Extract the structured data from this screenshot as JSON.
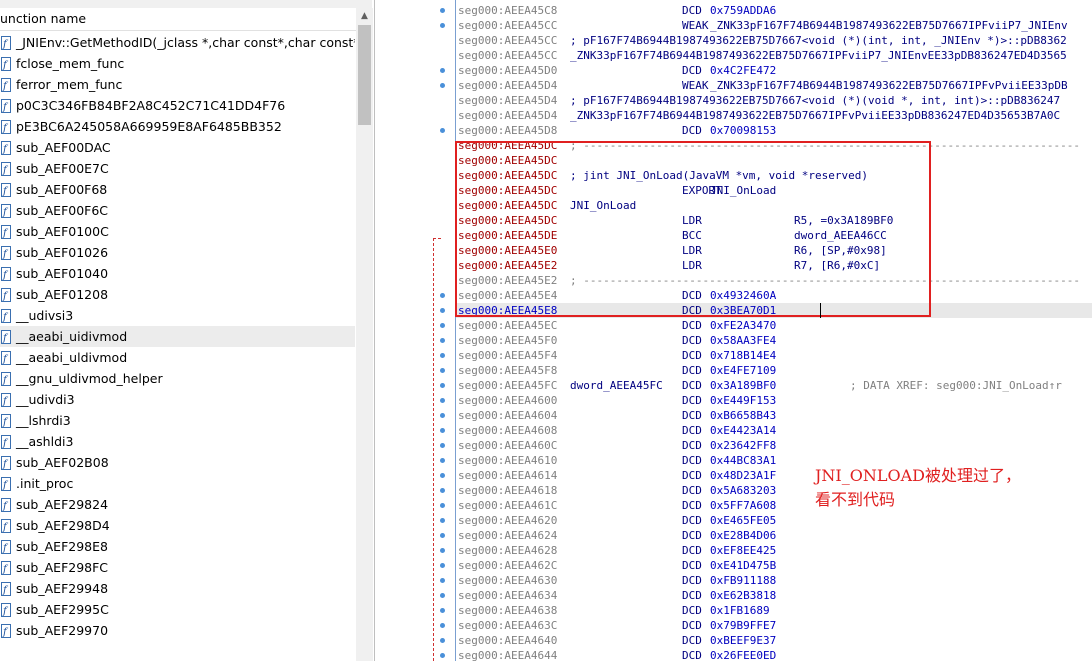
{
  "functions_window": {
    "column_header": "unction name",
    "items": [
      {
        "label": "_JNIEnv::GetMethodID(_jclass *,char const*,char const*)"
      },
      {
        "label": "fclose_mem_func"
      },
      {
        "label": "ferror_mem_func"
      },
      {
        "label": "p0C3C346FB84BF2A8C452C71C41DD4F76"
      },
      {
        "label": "pE3BC6A245058A669959E8AF6485BB352"
      },
      {
        "label": "sub_AEF00DAC"
      },
      {
        "label": "sub_AEF00E7C"
      },
      {
        "label": "sub_AEF00F68"
      },
      {
        "label": "sub_AEF00F6C"
      },
      {
        "label": "sub_AEF0100C"
      },
      {
        "label": "sub_AEF01026"
      },
      {
        "label": "sub_AEF01040"
      },
      {
        "label": "sub_AEF01208"
      },
      {
        "label": "__udivsi3"
      },
      {
        "label": "__aeabi_uidivmod",
        "selected": true
      },
      {
        "label": "__aeabi_uldivmod"
      },
      {
        "label": "__gnu_uldivmod_helper"
      },
      {
        "label": "__udivdi3"
      },
      {
        "label": "__lshrdi3"
      },
      {
        "label": "__ashldi3"
      },
      {
        "label": "sub_AEF02B08"
      },
      {
        "label": ".init_proc"
      },
      {
        "label": "sub_AEF29824"
      },
      {
        "label": "sub_AEF298D4"
      },
      {
        "label": "sub_AEF298E8"
      },
      {
        "label": "sub_AEF298FC"
      },
      {
        "label": "sub_AEF29948"
      },
      {
        "label": "sub_AEF2995C"
      },
      {
        "label": "sub_AEF29970"
      }
    ]
  },
  "disassembly": {
    "lines": [
      {
        "addr": "seg000:AEEA45C8",
        "mnem": "DCD",
        "ops": "0x759ADDA6"
      },
      {
        "addr": "seg000:AEEA45CC",
        "mnem": "WEAK",
        "ops": "_ZNK33pF167F74B6944B1987493622EB75D7667IPFviiP7_JNIEnv"
      },
      {
        "addr": "seg000:AEEA45CC",
        "comment": "; pF167F74B6944B1987493622EB75D7667<void (*)(int, int, _JNIEnv *)>::pDB8362"
      },
      {
        "addr": "seg000:AEEA45CC",
        "label": "_ZNK33pF167F74B6944B1987493622EB75D7667IPFviiP7_JNIEnvEE33pDB836247ED4D3565"
      },
      {
        "addr": "seg000:AEEA45D0",
        "mnem": "DCD",
        "ops": "0x4C2FE472"
      },
      {
        "addr": "seg000:AEEA45D4",
        "mnem": "WEAK",
        "ops": "_ZNK33pF167F74B6944B1987493622EB75D7667IPFvPviiEE33pDB"
      },
      {
        "addr": "seg000:AEEA45D4",
        "comment": "; pF167F74B6944B1987493622EB75D7667<void (*)(void *, int, int)>::pDB836247"
      },
      {
        "addr": "seg000:AEEA45D4",
        "label": "_ZNK33pF167F74B6944B1987493622EB75D7667IPFvPviiEE33pDB836247ED4D35653B7A0C"
      },
      {
        "addr": "seg000:AEEA45D8",
        "mnem": "DCD",
        "ops": "0x70098153"
      },
      {
        "addr": "seg000:AEEA45DC",
        "red": true,
        "sep": "; ---------------------------------------------------------------------------"
      },
      {
        "addr": "seg000:AEEA45DC",
        "red": true
      },
      {
        "addr": "seg000:AEEA45DC",
        "red": true,
        "comment": "; jint JNI_OnLoad(JavaVM *vm, void *reserved)"
      },
      {
        "addr": "seg000:AEEA45DC",
        "red": true,
        "mnem": "EXPORT",
        "ops": "JNI_OnLoad"
      },
      {
        "addr": "seg000:AEEA45DC",
        "red": true,
        "label": "JNI_OnLoad"
      },
      {
        "addr": "seg000:AEEA45DC",
        "red": true,
        "mnem": "LDR",
        "ops": "R5, =0x3A189BF0"
      },
      {
        "addr": "seg000:AEEA45DE",
        "red": true,
        "mnem": "BCC",
        "ops": "dword_AEEA46CC"
      },
      {
        "addr": "seg000:AEEA45E0",
        "red": true,
        "mnem": "LDR",
        "ops": "R6, [SP,#0x98]"
      },
      {
        "addr": "seg000:AEEA45E2",
        "red": true,
        "mnem": "LDR",
        "ops": "R7, [R6,#0xC]"
      },
      {
        "addr": "seg000:AEEA45E2",
        "sep": "; ---------------------------------------------------------------------------"
      },
      {
        "addr": "seg000:AEEA45E4",
        "mnem": "DCD",
        "ops": "0x4932460A"
      },
      {
        "addr": "seg000:AEEA45E8",
        "blue": true,
        "hl": true,
        "mnem": "DCD",
        "ops": "0x3BEA70D1"
      },
      {
        "addr": "seg000:AEEA45EC",
        "mnem": "DCD",
        "ops": "0xFE2A3470"
      },
      {
        "addr": "seg000:AEEA45F0",
        "mnem": "DCD",
        "ops": "0x58AA3FE4"
      },
      {
        "addr": "seg000:AEEA45F4",
        "mnem": "DCD",
        "ops": "0x718B14E4"
      },
      {
        "addr": "seg000:AEEA45F8",
        "mnem": "DCD",
        "ops": "0xE4FE7109"
      },
      {
        "addr": "seg000:AEEA45FC",
        "label": "dword_AEEA45FC",
        "mnem": "DCD",
        "ops": "0x3A189BF0",
        "xref": "; DATA XREF: seg000:JNI_OnLoad↑r"
      },
      {
        "addr": "seg000:AEEA4600",
        "mnem": "DCD",
        "ops": "0xE449F153"
      },
      {
        "addr": "seg000:AEEA4604",
        "mnem": "DCD",
        "ops": "0xB6658B43"
      },
      {
        "addr": "seg000:AEEA4608",
        "mnem": "DCD",
        "ops": "0xE4423A14"
      },
      {
        "addr": "seg000:AEEA460C",
        "mnem": "DCD",
        "ops": "0x23642FF8"
      },
      {
        "addr": "seg000:AEEA4610",
        "mnem": "DCD",
        "ops": "0x44BC83A1"
      },
      {
        "addr": "seg000:AEEA4614",
        "mnem": "DCD",
        "ops": "0x48D23A1F"
      },
      {
        "addr": "seg000:AEEA4618",
        "mnem": "DCD",
        "ops": "0x5A683203"
      },
      {
        "addr": "seg000:AEEA461C",
        "mnem": "DCD",
        "ops": "0x5FF7A608"
      },
      {
        "addr": "seg000:AEEA4620",
        "mnem": "DCD",
        "ops": "0xE465FE05"
      },
      {
        "addr": "seg000:AEEA4624",
        "mnem": "DCD",
        "ops": "0xE28B4D06"
      },
      {
        "addr": "seg000:AEEA4628",
        "mnem": "DCD",
        "ops": "0xEF8EE425"
      },
      {
        "addr": "seg000:AEEA462C",
        "mnem": "DCD",
        "ops": "0xE41D475B"
      },
      {
        "addr": "seg000:AEEA4630",
        "mnem": "DCD",
        "ops": "0xFB911188"
      },
      {
        "addr": "seg000:AEEA4634",
        "mnem": "DCD",
        "ops": "0xE62B3818"
      },
      {
        "addr": "seg000:AEEA4638",
        "mnem": "DCD",
        "ops": "0x1FB1689"
      },
      {
        "addr": "seg000:AEEA463C",
        "mnem": "DCD",
        "ops": "0x79B9FFE7"
      },
      {
        "addr": "seg000:AEEA4640",
        "mnem": "DCD",
        "ops": "0xBEEF9E37"
      },
      {
        "addr": "seg000:AEEA4644",
        "mnem": "DCD",
        "ops": "0x26FEE0ED"
      }
    ]
  },
  "annotation": {
    "line1": "JNI_ONLOAD被处理过了，",
    "line2": "看不到代码"
  },
  "colors": {
    "highlight_box": "#e02020",
    "address_red": "#a00000",
    "address_blue": "#0000c0"
  }
}
